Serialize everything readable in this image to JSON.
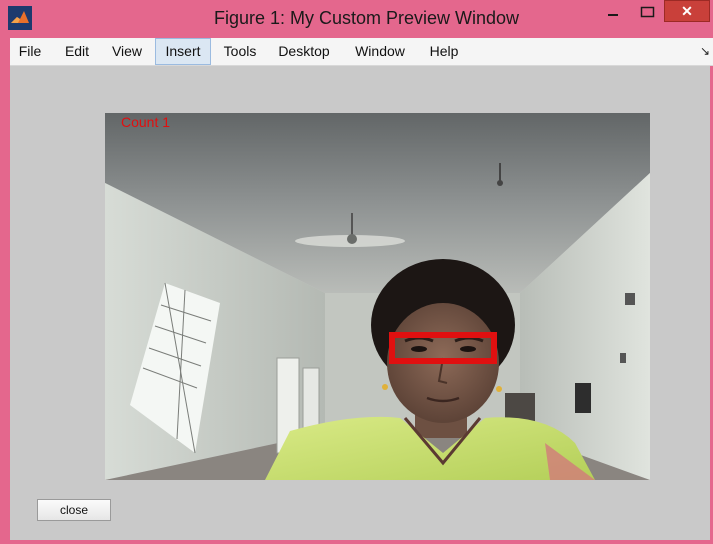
{
  "window": {
    "title": "Figure 1: My Custom Preview Window",
    "minimize_glyph": "–",
    "close_glyph": "✕"
  },
  "menu": {
    "items": [
      {
        "label": "File"
      },
      {
        "label": "Edit"
      },
      {
        "label": "View"
      },
      {
        "label": "Insert"
      },
      {
        "label": "Tools"
      },
      {
        "label": "Desktop"
      },
      {
        "label": "Window"
      },
      {
        "label": "Help"
      }
    ],
    "overflow_glyph": "↘"
  },
  "preview": {
    "count_label": "Count 1",
    "detection_color": "#e01010"
  },
  "buttons": {
    "close_label": "close"
  },
  "colors": {
    "titlebar": "#e4678d",
    "client_bg": "#c9c9c9",
    "close_button_bg": "#c9403a"
  },
  "icons": {
    "app": "matlab-logo-icon",
    "minimize": "minimize-icon",
    "maximize": "maximize-icon",
    "close": "close-icon"
  }
}
